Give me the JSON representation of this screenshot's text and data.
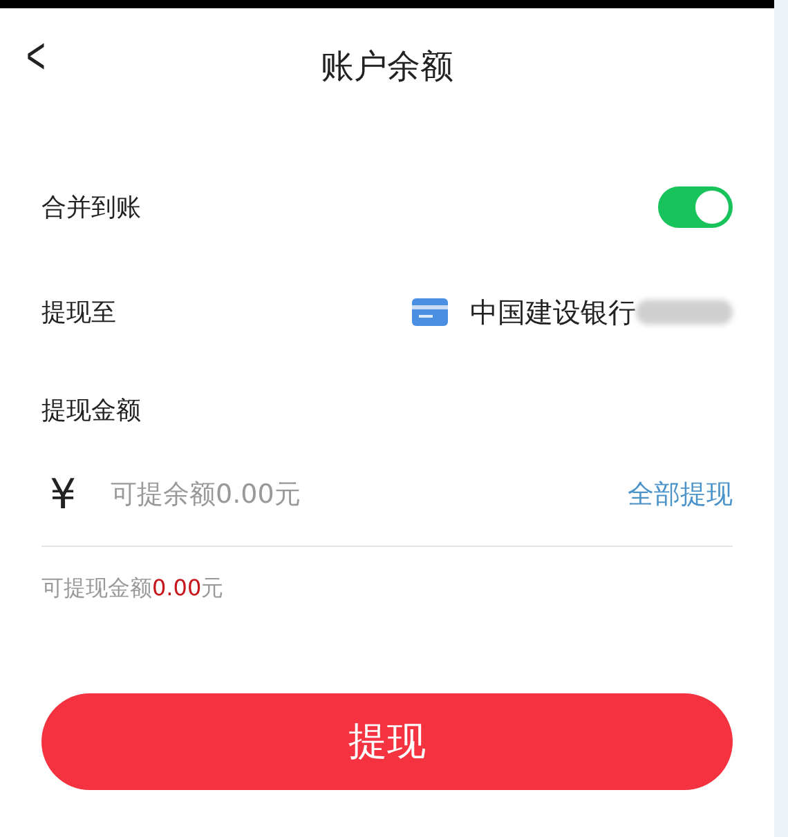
{
  "header": {
    "back": "<",
    "title": "账户余额"
  },
  "merge": {
    "label": "合并到账",
    "on": true
  },
  "withdraw_to": {
    "label": "提现至",
    "bank": "中国建设银行"
  },
  "amount": {
    "label": "提现金额",
    "currency": "¥",
    "placeholder": "可提余额0.00元",
    "all_link": "全部提现"
  },
  "available": {
    "prefix": "可提现金额",
    "value": "0.00",
    "suffix": "元"
  },
  "submit": "提现"
}
